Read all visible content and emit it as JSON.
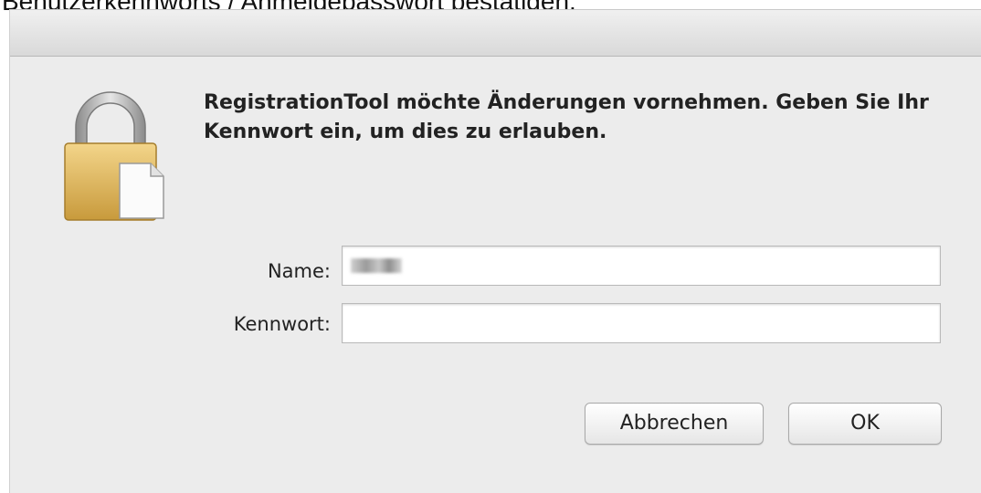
{
  "caption": "Benutzerkennworts / Anmeldepasswort bestätigen.",
  "dialog": {
    "message": "RegistrationTool möchte Änderungen vornehmen. Geben Sie Ihr Kennwort ein, um dies zu erlauben.",
    "icon": "lock-document-icon",
    "fields": {
      "name_label": "Name:",
      "name_value": "",
      "password_label": "Kennwort:",
      "password_value": ""
    },
    "buttons": {
      "cancel_label": "Abbrechen",
      "ok_label": "OK"
    }
  }
}
